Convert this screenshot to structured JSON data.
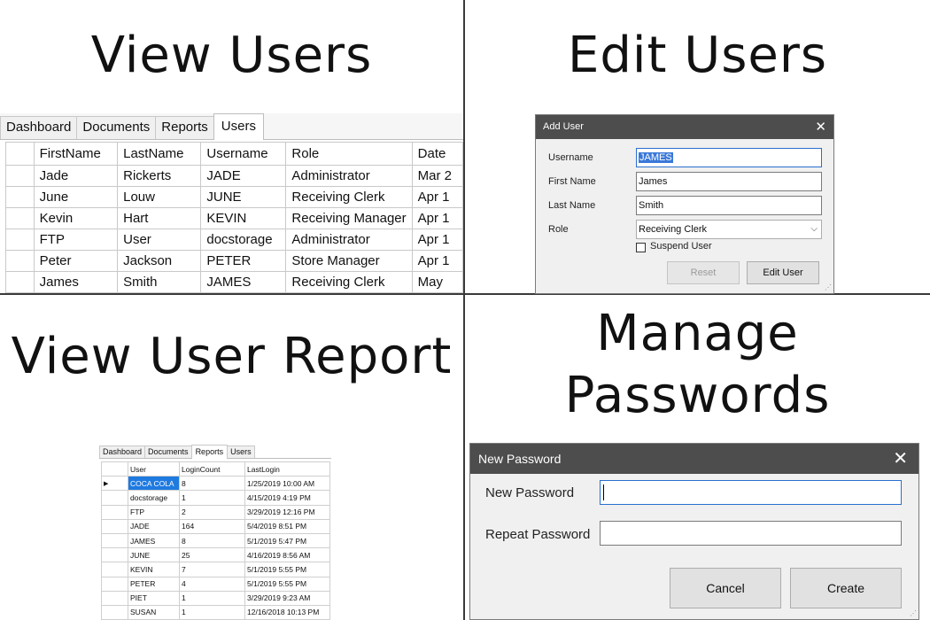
{
  "titles": {
    "view_users": "View Users",
    "edit_users": "Edit Users",
    "view_user_report": "View User Report",
    "manage_passwords_line1": "Manage",
    "manage_passwords_line2": "Passwords"
  },
  "tabs": [
    "Dashboard",
    "Documents",
    "Reports",
    "Users"
  ],
  "users_grid": {
    "columns": [
      "FirstName",
      "LastName",
      "Username",
      "Role",
      "Date"
    ],
    "rows": [
      [
        "Jade",
        "Rickerts",
        "JADE",
        "Administrator",
        "Mar 2"
      ],
      [
        "June",
        "Louw",
        "JUNE",
        "Receiving Clerk",
        "Apr 1"
      ],
      [
        "Kevin",
        "Hart",
        "KEVIN",
        "Receiving Manager",
        "Apr 1"
      ],
      [
        "FTP",
        "User",
        "docstorage",
        "Administrator",
        "Apr 1"
      ],
      [
        "Peter",
        "Jackson",
        "PETER",
        "Store Manager",
        "Apr 1"
      ],
      [
        "James",
        "Smith",
        "JAMES",
        "Receiving Clerk",
        "May"
      ]
    ]
  },
  "add_user_dialog": {
    "title": "Add User",
    "username_label": "Username",
    "username_value": "JAMES",
    "first_name_label": "First Name",
    "first_name_value": "James",
    "last_name_label": "Last Name",
    "last_name_value": "Smith",
    "role_label": "Role",
    "role_value": "Receiving Clerk",
    "suspend_label": "Suspend User",
    "reset_label": "Reset",
    "edit_label": "Edit User"
  },
  "report_grid": {
    "columns": [
      "User",
      "LoginCount",
      "LastLogin"
    ],
    "rows": [
      [
        "COCA COLA",
        "8",
        "1/25/2019 10:00 AM"
      ],
      [
        "docstorage",
        "1",
        "4/15/2019 4:19 PM"
      ],
      [
        "FTP",
        "2",
        "3/29/2019 12:16 PM"
      ],
      [
        "JADE",
        "164",
        "5/4/2019 8:51 PM"
      ],
      [
        "JAMES",
        "8",
        "5/1/2019 5:47 PM"
      ],
      [
        "JUNE",
        "25",
        "4/16/2019 8:56 AM"
      ],
      [
        "KEVIN",
        "7",
        "5/1/2019 5:55 PM"
      ],
      [
        "PETER",
        "4",
        "5/1/2019 5:55 PM"
      ],
      [
        "PIET",
        "1",
        "3/29/2019 9:23 AM"
      ],
      [
        "SUSAN",
        "1",
        "12/16/2018 10:13 PM"
      ]
    ]
  },
  "password_dialog": {
    "title": "New Password",
    "new_password_label": "New Password",
    "repeat_password_label": "Repeat Password",
    "cancel_label": "Cancel",
    "create_label": "Create"
  },
  "colors": {
    "titlebar": "#4d4d4d",
    "selection": "#1f7ae0",
    "dialog_bg": "#f0f0f0"
  },
  "icons": [
    "close-icon",
    "chevron-down-icon",
    "row-pointer-icon",
    "resize-grip-icon"
  ]
}
